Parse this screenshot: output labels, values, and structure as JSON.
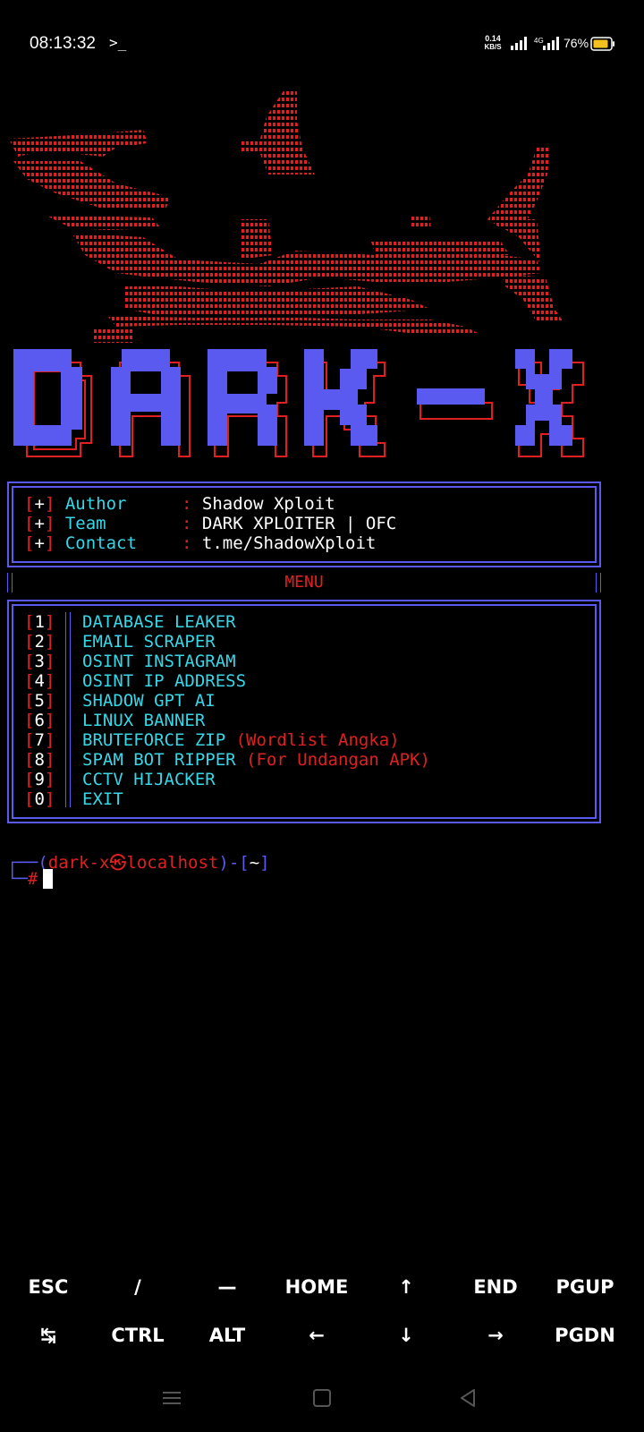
{
  "status_bar": {
    "time": "08:13:32",
    "terminal_icon": "terminal-prompt-icon",
    "net_speed_value": "0.14",
    "net_speed_unit": "KB/S",
    "lte_label": "4G",
    "battery": "76%"
  },
  "banner": {
    "logo_text": "DARK-X",
    "logo_fill": "#5a5af0",
    "logo_outline": "#e02020",
    "art_color": "#e02020"
  },
  "info": {
    "rows": [
      {
        "marker": "+",
        "label": "Author",
        "value": "Shadow Xploit"
      },
      {
        "marker": "+",
        "label": "Team",
        "value": "DARK XPLOITER | OFC"
      },
      {
        "marker": "+",
        "label": "Contact",
        "value": "t.me/ShadowXploit"
      }
    ],
    "separator": ":"
  },
  "menu": {
    "title": "MENU",
    "items": [
      {
        "num": "1",
        "label": "DATABASE LEAKER",
        "note": ""
      },
      {
        "num": "2",
        "label": "EMAIL SCRAPER",
        "note": ""
      },
      {
        "num": "3",
        "label": "OSINT INSTAGRAM",
        "note": ""
      },
      {
        "num": "4",
        "label": "OSINT IP ADDRESS",
        "note": ""
      },
      {
        "num": "5",
        "label": "SHADOW GPT AI",
        "note": ""
      },
      {
        "num": "6",
        "label": "LINUX BANNER",
        "note": ""
      },
      {
        "num": "7",
        "label": "BRUTEFORCE ZIP",
        "note": "(Wordlist Angka)"
      },
      {
        "num": "8",
        "label": "SPAM BOT RIPPER",
        "note": "(For Undangan APK)"
      },
      {
        "num": "9",
        "label": "CCTV HIJACKER",
        "note": ""
      },
      {
        "num": "0",
        "label": "EXIT",
        "note": ""
      }
    ]
  },
  "prompt": {
    "user": "dark-x",
    "host": "localhost",
    "path": "~",
    "symbol": "#"
  },
  "extra_keys": {
    "row1": [
      "ESC",
      "/",
      "—",
      "HOME",
      "↑",
      "END",
      "PGUP"
    ],
    "row2": [
      "↹",
      "CTRL",
      "ALT",
      "←",
      "↓",
      "→",
      "PGDN"
    ]
  },
  "colors": {
    "accent_blue": "#5a5af0",
    "accent_red": "#e02020",
    "accent_cyan": "#37d7e8"
  }
}
